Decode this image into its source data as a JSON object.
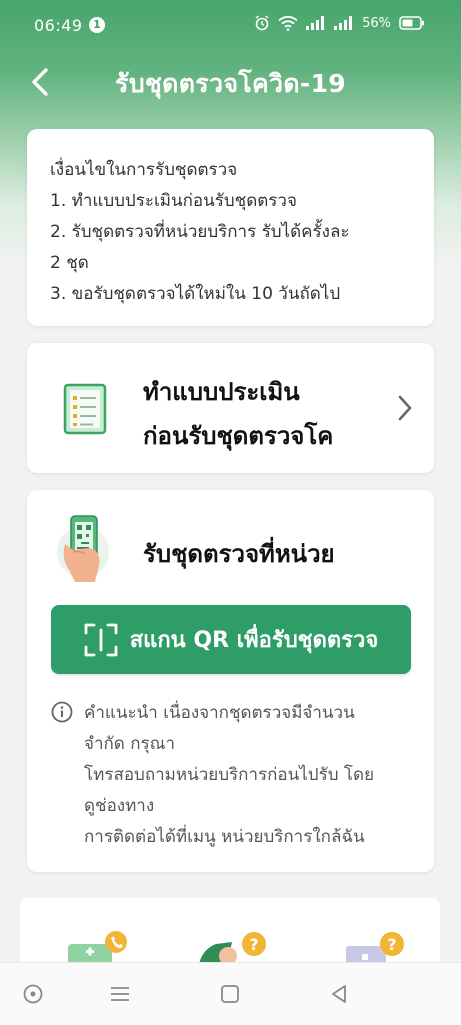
{
  "status": {
    "time": "06:49",
    "notification_count": "1",
    "battery": "56%"
  },
  "header": {
    "title": "รับชุดตรวจโควิด-19"
  },
  "conditions": {
    "lines": [
      "เงื่อนไขในการรับชุดตรวจ",
      "1. ทำแบบประเมินก่อนรับชุดตรวจ",
      "2. รับชุดตรวจที่หน่วยบริการ รับได้ครั้งละ",
      "2 ชุด",
      "3. ขอรับชุดตรวจได้ใหม่ใน 10 วันถัดไป"
    ]
  },
  "assessment": {
    "title_line1": "ทำแบบประเมิน",
    "title_line2": "ก่อนรับชุดตรวจโค"
  },
  "pickup": {
    "title": "รับชุดตรวจที่หน่วย",
    "scan_button": "สแกน QR เพื่อรับชุดตรวจ",
    "advice_lines": [
      "คำแนะนำ เนื่องจากชุดตรวจมีจำนวน",
      "จำกัด กรุณา",
      "โทรสอบถามหน่วยบริการก่อนไปรับ โดย",
      "ดูช่องทาง",
      "การติดต่อได้ที่เมนู หน่วยบริการใกล้ฉัน"
    ]
  },
  "icons": {
    "back": "back-arrow-icon",
    "checklist": "checklist-icon",
    "phone_qr": "phone-qr-icon",
    "scan": "scan-icon",
    "info": "info-icon",
    "chevron": "chevron-right-icon"
  },
  "colors": {
    "primary": "#2f9d67",
    "header_green": "#46a66b"
  }
}
